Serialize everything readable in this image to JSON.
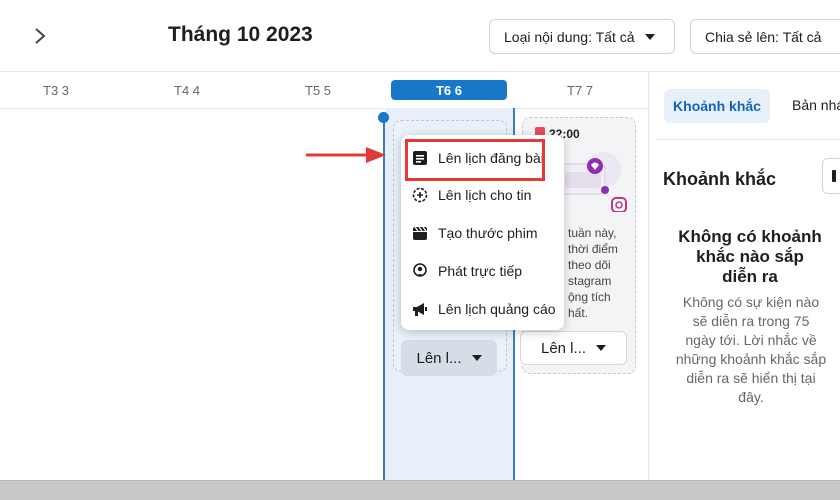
{
  "header": {
    "month_title": "Tháng 10 2023",
    "filter_content_type": "Loại nội dung: Tất cả",
    "filter_shared_to": "Chia sẻ lên: Tất cả"
  },
  "days": [
    {
      "label": "T3 3"
    },
    {
      "label": "T4 4"
    },
    {
      "label": "T5 5"
    },
    {
      "label": "T6 6",
      "active": true
    },
    {
      "label": "T7 7"
    }
  ],
  "slot": {
    "button_label": "Lên l..."
  },
  "t7_card": {
    "time": "22:00",
    "text": "tuần này,\nthời điểm\ntheo dõi\nstagram\nộng tích\nhất.",
    "button_label": "Lên l..."
  },
  "menu": {
    "items": [
      {
        "label": "Lên lịch đăng bài",
        "icon": "post-icon"
      },
      {
        "label": "Lên lịch cho tin",
        "icon": "story-icon"
      },
      {
        "label": "Tạo thước phim",
        "icon": "reel-icon"
      },
      {
        "label": "Phát trực tiếp",
        "icon": "live-icon"
      },
      {
        "label": "Lên lịch quảng cáo",
        "icon": "megaphone-icon"
      }
    ]
  },
  "right_panel": {
    "tab_moments": "Khoảnh khắc",
    "tab_drafts": "Bản nhá",
    "heading": "Khoảnh khắc",
    "empty_title": "Không có khoảnh\nkhắc nào sắp\ndiễn ra",
    "empty_desc": "Không có sự kiện nào\nsẽ diễn ra trong 75\nngày tới. Lời nhắc về\nnhững khoảnh khắc sắp\ndiễn ra sẽ hiển thị tại\nđây."
  },
  "colors": {
    "accent": "#1877c9",
    "annotation_red": "#e53935"
  }
}
